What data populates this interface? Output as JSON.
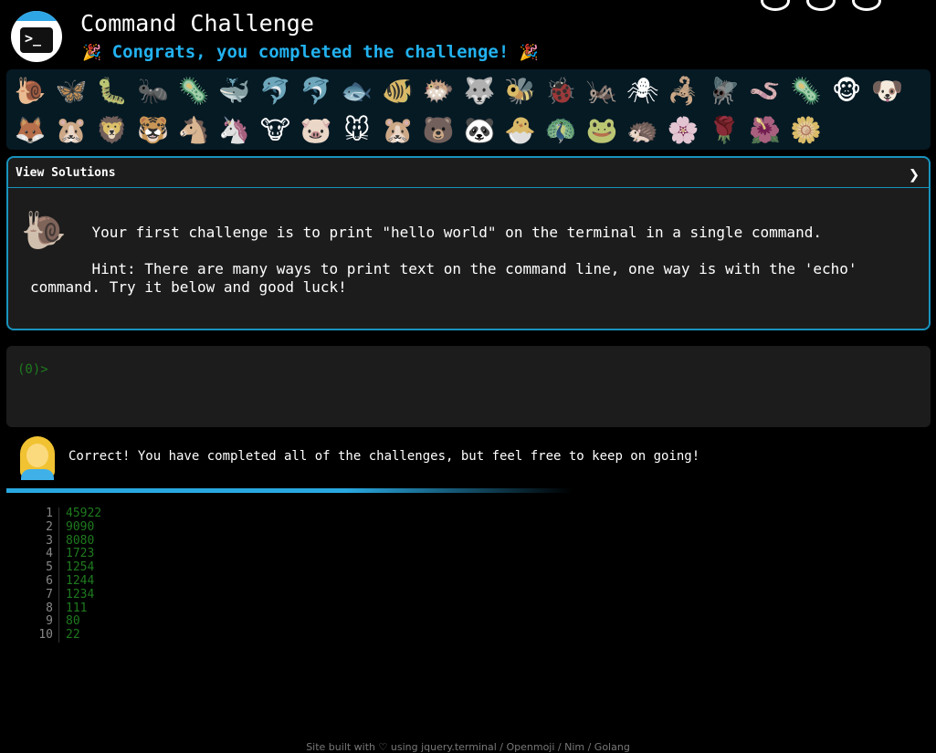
{
  "header": {
    "title": "Command Challenge",
    "subtitle": "Congrats, you completed the challenge!",
    "party_icon": "🎉",
    "logo_prompt": ">_"
  },
  "emoji_grid": {
    "items": [
      "🐌",
      "🦋",
      "🐛",
      "🐜",
      "🦠",
      "🐳",
      "🐬",
      "🐬",
      "🐟",
      "🐠",
      "🐡",
      "🐺",
      "🐝",
      "🐞",
      "🦗",
      "🕷",
      "🦂",
      "🪰",
      "🪱",
      "🦠",
      "🐵",
      "🐶",
      "🦊",
      "🐹",
      "🦁",
      "🐯",
      "🐴",
      "🦄",
      "🐮",
      "🐷",
      "🐭",
      "🐹",
      "🐻",
      "🐼",
      "🐣",
      "🦚",
      "🐸",
      "🦔",
      "🌸",
      "🌹",
      "🌺",
      "🌼"
    ],
    "active_index": 0
  },
  "solutions_panel": {
    "header_label": "View Solutions",
    "chevron": "❯",
    "snail_icon": "🐌",
    "challenge_text": "       Your first challenge is to print \"hello world\" on the terminal in a single command.\n\n       Hint: There are many ways to print text on the command line, one way is with the 'echo'\ncommand. Try it below and good luck!"
  },
  "terminal": {
    "prompt": "(0)",
    "prompt_symbol": ">"
  },
  "status": {
    "message": "Correct! You have completed all of the challenges, but feel free to keep on going!",
    "progress": 1.0
  },
  "history": [
    {
      "n": "1",
      "v": "45922"
    },
    {
      "n": "2",
      "v": "9090"
    },
    {
      "n": "3",
      "v": "8080"
    },
    {
      "n": "4",
      "v": "1723"
    },
    {
      "n": "5",
      "v": "1254"
    },
    {
      "n": "6",
      "v": "1244"
    },
    {
      "n": "7",
      "v": "1234"
    },
    {
      "n": "8",
      "v": "111"
    },
    {
      "n": "9",
      "v": "80"
    },
    {
      "n": "10",
      "v": "22"
    }
  ],
  "footer": {
    "text": "Site built with ♡ using jquery.terminal / Openmoji / Nim / Golang"
  }
}
